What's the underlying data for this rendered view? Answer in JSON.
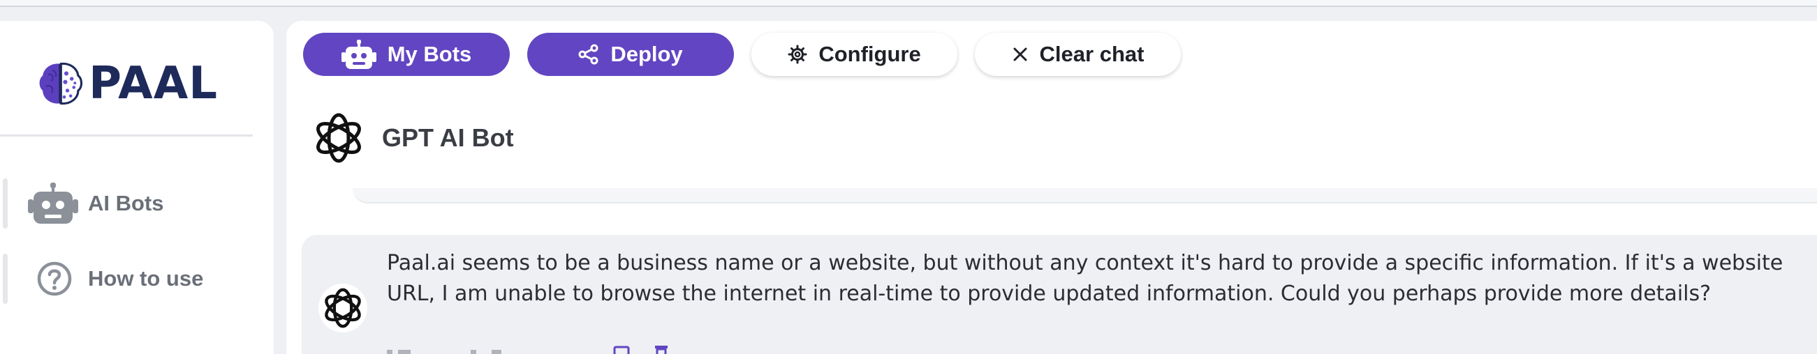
{
  "brand": {
    "name": "PAAL"
  },
  "sidebar": {
    "items": [
      {
        "label": "AI Bots",
        "icon": "robot-icon"
      },
      {
        "label": "How to use",
        "icon": "question-circle-icon"
      }
    ]
  },
  "toolbar": {
    "my_bots_label": "My Bots",
    "deploy_label": "Deploy",
    "configure_label": "Configure",
    "clear_chat_label": "Clear chat"
  },
  "bot": {
    "name": "GPT AI Bot",
    "icon": "openai-logo-icon"
  },
  "chat": {
    "messages": [
      {
        "role": "assistant",
        "text": "Paal.ai seems to be a business name or a website, but without any context it's hard to provide a specific information. If it's a website URL, I am unable to browse the internet in real-time to provide updated information. Could you perhaps provide more details?"
      }
    ]
  },
  "colors": {
    "primary": "#6245c2",
    "brand_text": "#1e2a5a",
    "background": "#eef0f4"
  }
}
